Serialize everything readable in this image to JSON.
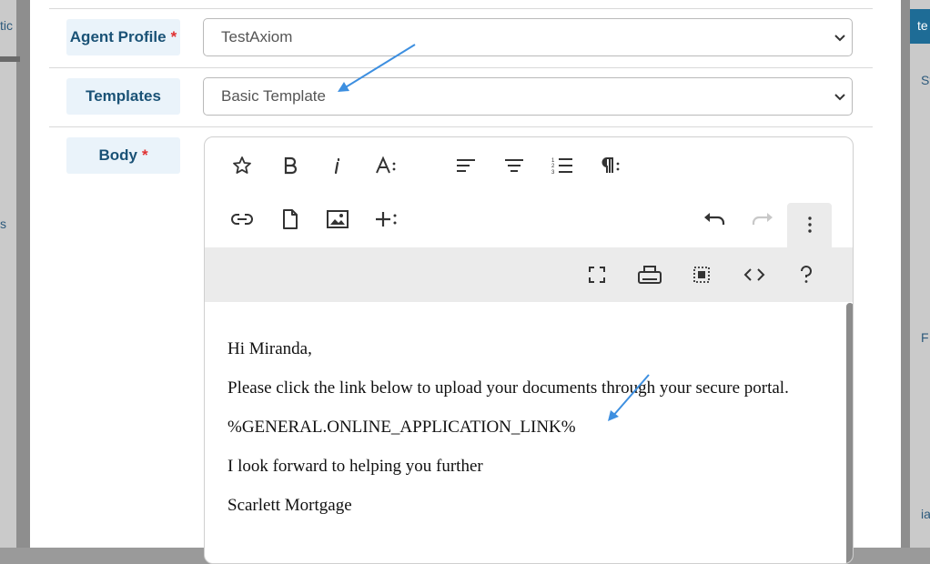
{
  "background": {
    "left_fragments": [
      "tic",
      "s"
    ],
    "right_fragments": [
      "te",
      "St",
      "F",
      "ia"
    ]
  },
  "form": {
    "agent_profile": {
      "label": "Agent Profile",
      "required_mark": "*",
      "value": "TestAxiom"
    },
    "templates": {
      "label": "Templates",
      "value": "Basic Template"
    },
    "body": {
      "label": "Body",
      "required_mark": "*"
    }
  },
  "editor": {
    "toolbar_row1": [
      "favorite-icon",
      "bold-icon",
      "italic-icon",
      "font-size-icon",
      "align-left-icon",
      "align-center-icon",
      "ordered-list-icon",
      "paragraph-format-icon"
    ],
    "toolbar_row2": [
      "insert-link-icon",
      "insert-file-icon",
      "insert-image-icon",
      "insert-more-icon",
      "undo-icon",
      "redo-icon",
      "more-options-icon"
    ],
    "toolbar_row3": [
      "fullscreen-icon",
      "print-icon",
      "select-all-icon",
      "code-view-icon",
      "help-icon"
    ],
    "content": {
      "greeting": "Hi Miranda,",
      "line1": "Please click the link below to upload your documents through your secure portal.",
      "link_token": "%GENERAL.ONLINE_APPLICATION_LINK%",
      "line2": "I look forward to helping you further",
      "signature": "Scarlett Mortgage"
    }
  },
  "colors": {
    "label_bg": "#eaf3fa",
    "label_text": "#1a5276",
    "required": "#e03030",
    "annotation_arrow": "#3d8fe0"
  }
}
